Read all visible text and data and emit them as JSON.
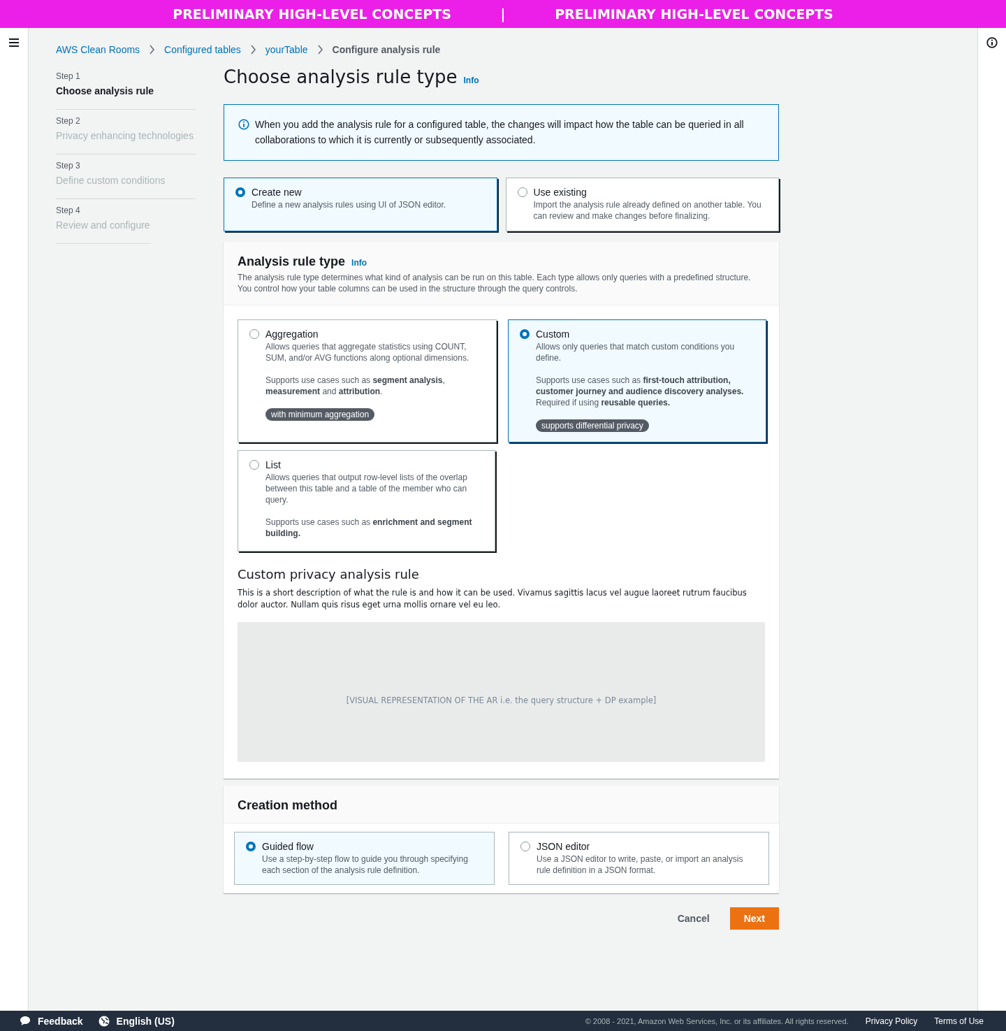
{
  "banner": {
    "texts": [
      "PRELIMINARY HIGH-LEVEL CONCEPTS",
      "PRELIMINARY HIGH-LEVEL CONCEPTS"
    ],
    "separator": "|"
  },
  "breadcrumbs": [
    {
      "label": "AWS Clean Rooms",
      "link": true
    },
    {
      "label": "Configured tables",
      "link": true
    },
    {
      "label": "yourTable",
      "link": true
    },
    {
      "label": "Configure analysis rule",
      "link": false
    }
  ],
  "steps": [
    {
      "step": "Step 1",
      "title": "Choose analysis rule",
      "selected": true
    },
    {
      "step": "Step 2",
      "title": "Privacy enhancing technologies",
      "selected": false
    },
    {
      "step": "Step 3",
      "title": "Define custom conditions",
      "selected": false
    },
    {
      "step": "Step 4",
      "title": "Review and configure",
      "selected": false
    }
  ],
  "page_title": "Choose analysis rule type",
  "page_info": "Info",
  "alert": "When you add the analysis rule for a configured table, the changes will impact how the table can be queried in all collaborations to which it is currently or subsequently associated.",
  "source_options": [
    {
      "title": "Create new",
      "description": "Define a new analysis rules using UI of JSON editor.",
      "selected": true
    },
    {
      "title": "Use existing",
      "description": "Import the analysis rule already defined on another table. You can review and make changes before finalizing.",
      "selected": false
    }
  ],
  "analysis_rule_type": {
    "title": "Analysis rule type",
    "info": "Info",
    "description": "The analysis rule type determines what kind of analysis can be run on this table. Each type allows only queries with a predefined structure. You control how your table columns can be used in the structure through the query controls.",
    "options": [
      {
        "title": "Aggregation",
        "description": "Allows queries that aggregate statistics using COUNT, SUM, and/or AVG functions along optional dimensions.",
        "use_cases": "Supports use cases such as **segment analysis**, **measurement** and **attribution**.",
        "tag": "with minimum aggregation",
        "selected": false
      },
      {
        "title": "Custom",
        "description": "Allows only queries that match  custom conditions you define.",
        "use_cases": "Supports use cases such as **first-touch attribution, customer journey and audience discovery analyses.** Required if using **reusable queries.**",
        "tag": "supports differential privacy",
        "selected": true
      },
      {
        "title": "List",
        "description": "Allows queries that output row-level lists of the overlap between this table and a table of the member who can query.",
        "use_cases": "Supports use cases such as **enrichment and segment building.**",
        "selected": false
      }
    ]
  },
  "custom_rule": {
    "title": "Custom privacy analysis rule",
    "description": "This is a short description of what the rule is and how it can be used. Vivamus sagittis lacus vel augue laoreet rutrum faucibus dolor auctor. Nullam quis risus eget urna mollis ornare vel eu leo.",
    "visual_placeholder": "[VISUAL REPRESENTATION OF THE AR i.e. the query structure  + DP example]"
  },
  "creation_method": {
    "title": "Creation method",
    "options": [
      {
        "title": "Guided flow",
        "description": "Use a step-by-step flow to guide you through specifying each section of the analysis rule definition.",
        "selected": true
      },
      {
        "title": "JSON editor",
        "description": "Use a JSON editor to write, paste, or import an analysis rule definition in a JSON format.",
        "selected": false
      }
    ]
  },
  "actions": {
    "cancel": "Cancel",
    "next": "Next"
  },
  "footer": {
    "feedback": "Feedback",
    "language": "English (US)",
    "copyright": "© 2008 - 2021, Amazon Web Services, Inc. or its affiliates. All rights reserved.",
    "links": [
      "Privacy Policy",
      "Terms of Use"
    ]
  }
}
